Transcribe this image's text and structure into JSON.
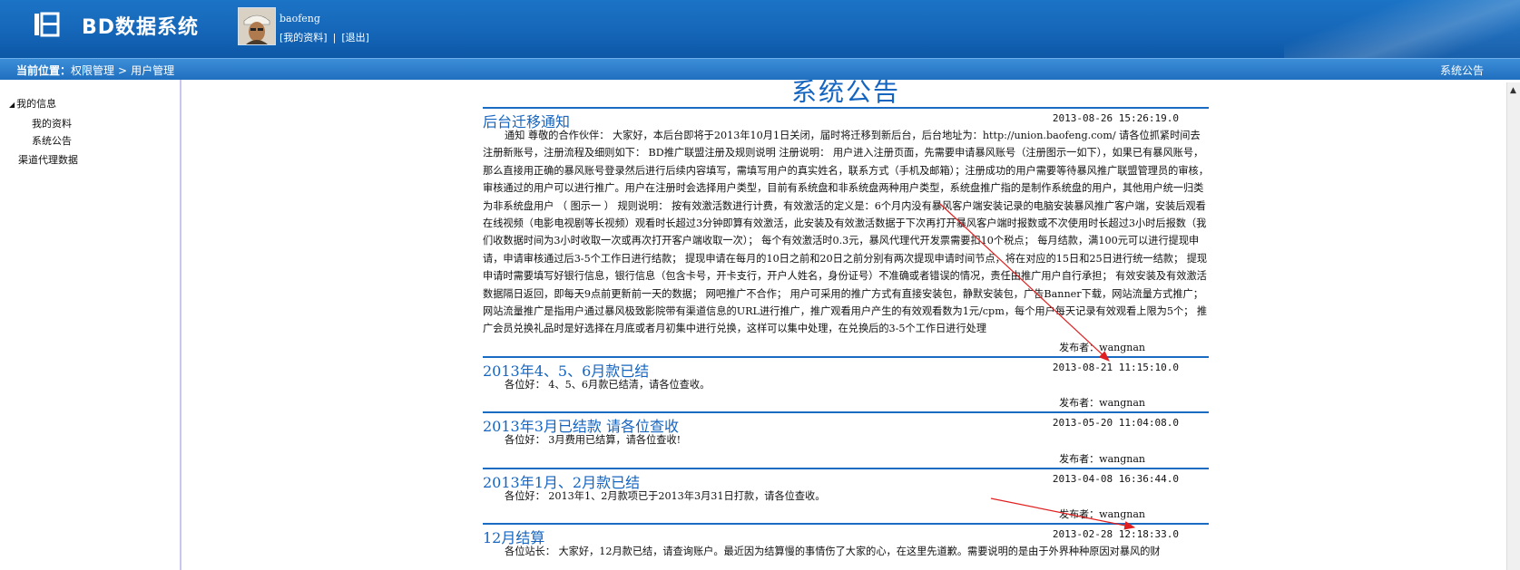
{
  "app": {
    "logo_text": "BD数据系统",
    "logo_icon": "grid-app-icon"
  },
  "user": {
    "name": "baofeng",
    "my_profile_link": "[我的资料]",
    "separator": "|",
    "logout_link": "[退出]"
  },
  "breadcrumb": {
    "label": "当前位置：",
    "item1": "权限管理",
    "arrow": ">",
    "item2": "用户管理",
    "right_text": "系统公告"
  },
  "sidebar": {
    "group_label": "我的信息",
    "items": [
      {
        "label": "我的资料"
      },
      {
        "label": "系统公告"
      }
    ],
    "group2_label": "渠道代理数据"
  },
  "board": {
    "title": "系统公告",
    "notices": [
      {
        "title": "后台迁移通知",
        "date": "2013-08-26 15:26:19.0",
        "body": "通知 尊敬的合作伙伴： 大家好，本后台即将于2013年10月1日关闭，届时将迁移到新后台，后台地址为：http://union.baofeng.com/ 请各位抓紧时间去注册新账号，注册流程及细则如下： BD推广联盟注册及规则说明 注册说明： 用户进入注册页面，先需要申请暴风账号（注册图示一如下），如果已有暴风账号，那么直接用正确的暴风账号登录然后进行后续内容填写，需填写用户的真实姓名，联系方式（手机及邮箱）；注册成功的用户需要等待暴风推广联盟管理员的审核，审核通过的用户可以进行推广。用户在注册时会选择用户类型，目前有系统盘和非系统盘两种用户类型，系统盘推广指的是制作系统盘的用户，其他用户统一归类为非系统盘用户 （ 图示一 ） 规则说明： 按有效激活数进行计费，有效激活的定义是：6个月内没有暴风客户端安装记录的电脑安装暴风推广客户端，安装后观看在线视频（电影电视剧等长视频）观看时长超过3分钟即算有效激活，此安装及有效激活数据于下次再打开暴风客户端时报数或不次使用时长超过3小时后报数（我们收数据时间为3小时收取一次或再次打开客户端收取一次）； 每个有效激活时0.3元，暴风代理代开发票需要扣10个税点； 每月结款，满100元可以进行提现申请，申请审核通过后3-5个工作日进行结款； 提现申请在每月的10日之前和20日之前分别有两次提现申请时间节点，将在对应的15日和25日进行统一结款； 提现申请时需要填写好银行信息，银行信息（包含卡号，开卡支行，开户人姓名，身份证号）不准确或者错误的情况，责任由推广用户自行承担； 有效安装及有效激活数据隔日返回，即每天9点前更新前一天的数据； 网吧推广不合作； 用户可采用的推广方式有直接安装包，静默安装包，广告Banner下载，网站流量方式推广； 网站流量推广是指用户通过暴风极致影院带有渠道信息的URL进行推广，推广观看用户产生的有效观看数为1元/cpm，每个用户每天记录有效观看上限为5个； 推广会员兑换礼品时是好选择在月底或者月初集中进行兑换，这样可以集中处理，在兑换后的3-5个工作日进行处理",
        "publisher": "发布者：wangnan"
      },
      {
        "title": "2013年4、5、6月款已结",
        "date": "2013-08-21 11:15:10.0",
        "body": "各位好： 4、5、6月款已结清，请各位查收。",
        "publisher": "发布者：wangnan"
      },
      {
        "title": "2013年3月已结款  请各位查收",
        "date": "2013-05-20 11:04:08.0",
        "body": "各位好： 3月费用已结算，请各位查收!",
        "publisher": "发布者：wangnan"
      },
      {
        "title": "2013年1月、2月款已结",
        "date": "2013-04-08 16:36:44.0",
        "body": "各位好： 2013年1、2月款项已于2013年3月31日打款，请各位查收。",
        "publisher": "发布者：wangnan"
      },
      {
        "title": "12月结算",
        "date": "2013-02-28 12:18:33.0",
        "body": "各位站长： 大家好，12月款已结，请查询账户。最近因为结算慢的事情伤了大家的心，在这里先道歉。需要说明的是由于外界种种原因对暴风的财",
        "publisher": ""
      }
    ]
  },
  "colors": {
    "header_blue": "#1566b8",
    "title_blue": "#1565c0",
    "rule_blue": "#1a6bc2",
    "annotation_red": "#e02020"
  },
  "icons": {
    "avatar": "user-avatar-photo",
    "tree_toggle": "triangle-down-icon",
    "scroll_up": "scroll-up-arrow-icon"
  }
}
